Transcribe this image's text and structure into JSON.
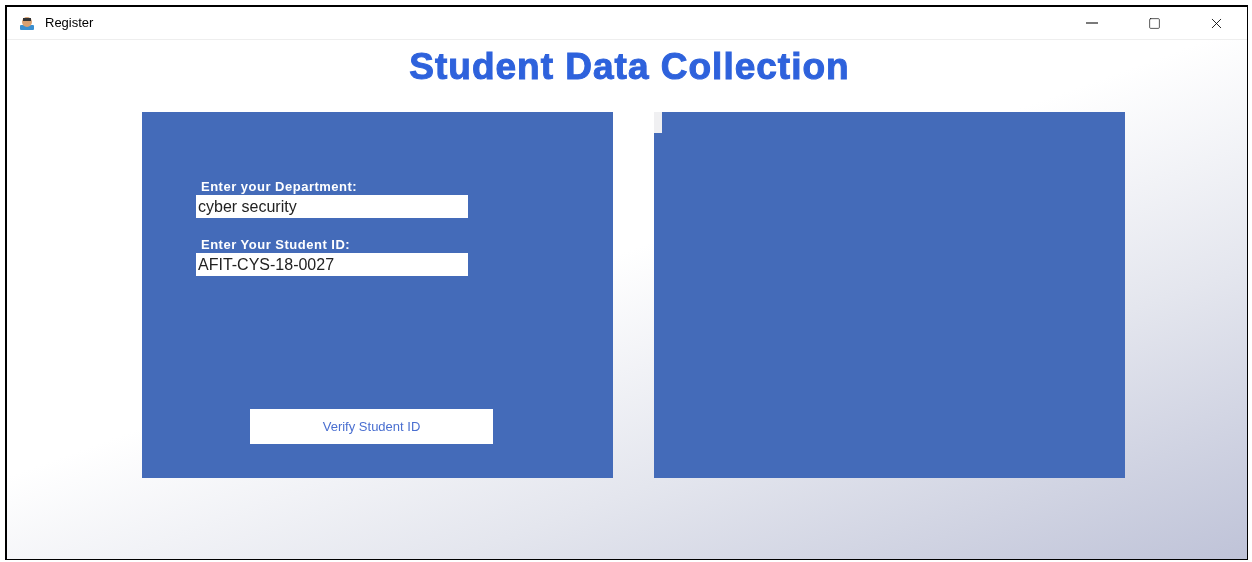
{
  "window": {
    "title": "Register"
  },
  "heading": "Student Data Collection",
  "form": {
    "fields": [
      {
        "label": "Enter your Department:",
        "value": "cyber security"
      },
      {
        "label": "Enter Your Student ID:",
        "value": "AFIT-CYS-18-0027"
      }
    ],
    "button": "Verify Student ID"
  }
}
